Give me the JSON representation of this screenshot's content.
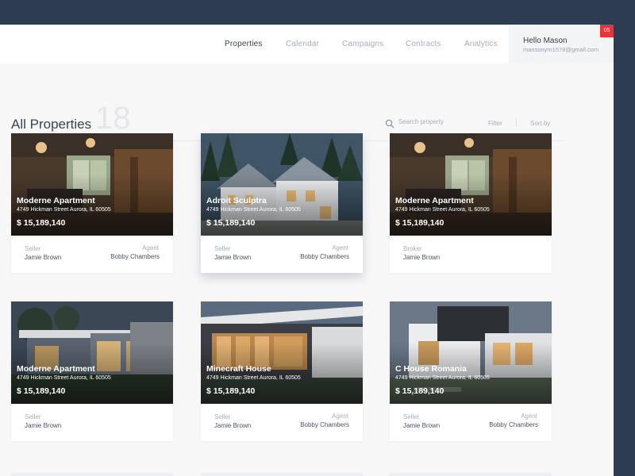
{
  "nav": {
    "items": [
      "Properties",
      "Calendar",
      "Campaigns",
      "Contracts",
      "Analytics"
    ],
    "user": {
      "name": "Hello Mason",
      "email": "mansonym1578@gmail.com",
      "badge": "05"
    }
  },
  "header": {
    "title": "All Properties",
    "count": "18",
    "search_placeholder": "Search property",
    "filter_label": "Filter",
    "sort_label": "Sort by"
  },
  "properties": [
    {
      "name": "Moderne Apartment",
      "address": "4749 Hickman Street Aurora, IL 60505",
      "price": "$ 15,189,140",
      "left_label": "Seller",
      "left_value": "Jamie Brown",
      "right_label": "Agent",
      "right_value": "Bobby Chambers"
    },
    {
      "name": "Adroit Sculptra",
      "address": "4749 Hickman Street Aurora, IL 60505",
      "price": "$ 15,189,140",
      "left_label": "Seller",
      "left_value": "Jamie Brown",
      "right_label": "Agent",
      "right_value": "Bobby Chambers"
    },
    {
      "name": "Moderne Apartment",
      "address": "4749 Hickman Street Aurora, IL 60505",
      "price": "$ 15,189,140",
      "left_label": "Broker",
      "left_value": "Jamie Brown"
    },
    {
      "name": "Moderne Apartment",
      "address": "4749 Hickman Street Aurora, IL 60505",
      "price": "$ 15,189,140",
      "left_label": "Seller",
      "left_value": "Jamie Brown"
    },
    {
      "name": "Minecraft House",
      "address": "4749 Hickman Street Aurora, IL 60505",
      "price": "$ 15,189,140",
      "left_label": "Seller",
      "left_value": "Jamie Brown",
      "right_label": "Agent",
      "right_value": "Bobby Chambers"
    },
    {
      "name": "C House Romania",
      "address": "4749 Hickman Street Aurora, IL 60505",
      "price": "$ 15,189,140",
      "left_label": "Seller",
      "left_value": "Jamie Brown",
      "right_label": "Agent",
      "right_value": "Bobby Chambers"
    }
  ],
  "icons": {
    "search": "search-icon"
  },
  "colors": {
    "sidebar": "#2e3c52",
    "badge": "#e5353a",
    "page_bg": "#f7f7f8"
  }
}
